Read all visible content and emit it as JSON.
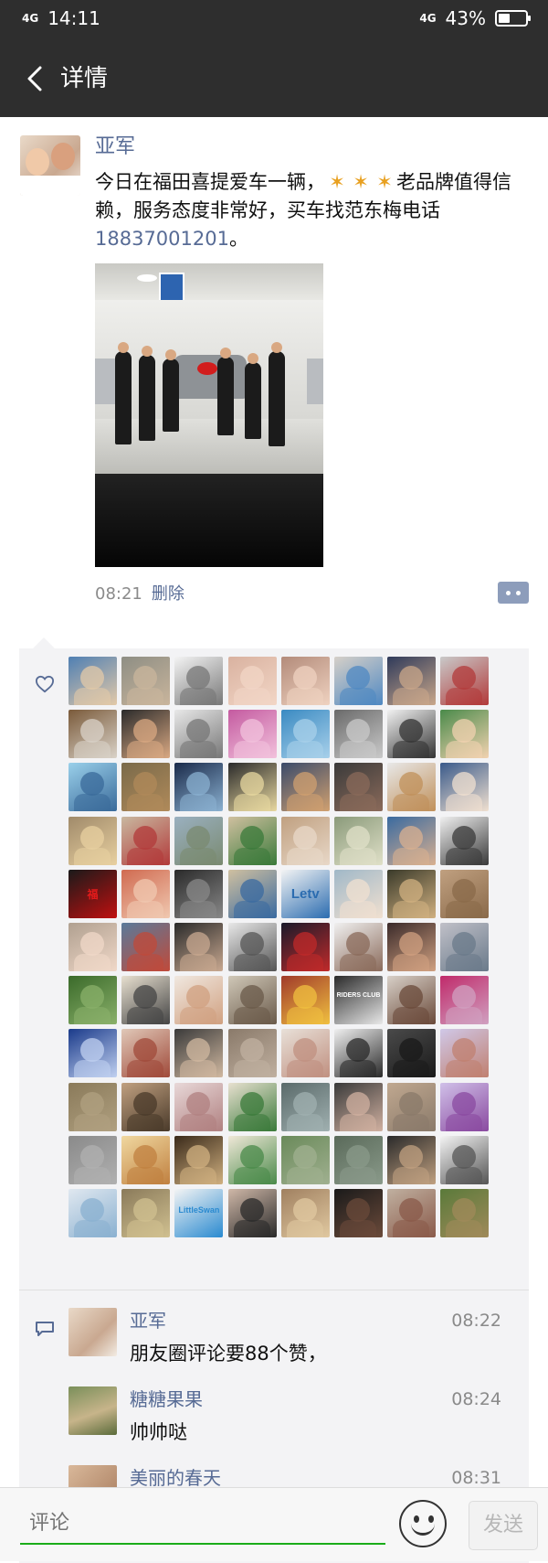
{
  "status_bar": {
    "net_left": "4G",
    "time": "14:11",
    "net_right": "4G",
    "battery": "43%",
    "battery_level": 0.43
  },
  "nav": {
    "title": "详情"
  },
  "post": {
    "author": "亚军",
    "text_part1": "今日在福田喜提爱车一辆，",
    "text_part2": "老品牌值得信赖，服务态度非常好，买车找范东梅电话",
    "phone": "18837001201",
    "text_end": "。",
    "time": "08:21",
    "delete_label": "删除"
  },
  "likes": {
    "count": 88,
    "special_labels": [
      "福",
      "Letv",
      "LittleSwan",
      "RIDERS CLUB"
    ]
  },
  "comments": [
    {
      "name": "亚军",
      "time": "08:22",
      "text": "朋友圈评论要88个赞，"
    },
    {
      "name": "糖糖果果",
      "time": "08:24",
      "text": "帅帅哒"
    },
    {
      "name": "美丽的春天",
      "time": "08:31",
      "text": ""
    }
  ],
  "input": {
    "placeholder": "评论",
    "send_label": "发送"
  },
  "colors": {
    "link": "#576b95",
    "bar": "#2e2e2e",
    "accent": "#1aad19"
  },
  "icons": [
    "back-arrow-icon",
    "heart-icon",
    "comment-icon",
    "more-dots-icon",
    "emoji-icon",
    "battery-icon",
    "signal-icon"
  ]
}
